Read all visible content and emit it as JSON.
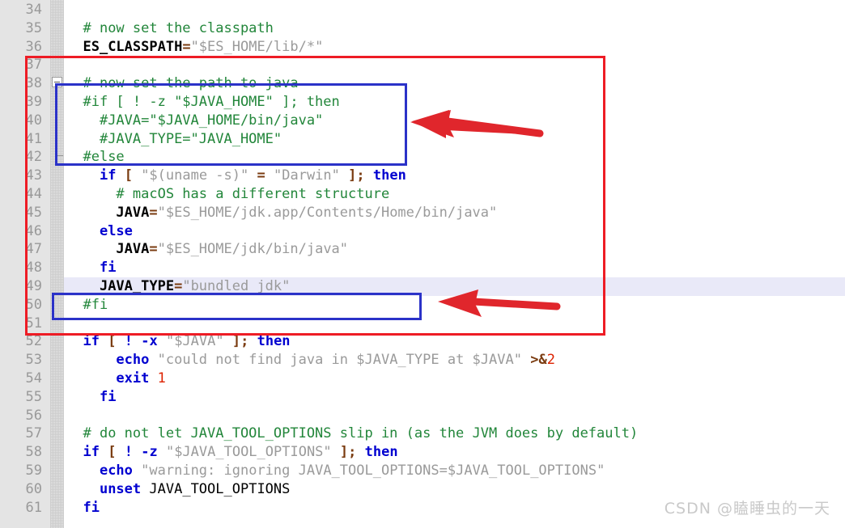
{
  "editor": {
    "first_line_number": 34,
    "highlighted_line": 49,
    "gutter_color": "#e4e4e4",
    "highlight_color": "#e9e9f8",
    "lines": [
      {
        "n": "34",
        "tokens": []
      },
      {
        "n": "35",
        "tokens": [
          {
            "t": "  ",
            "c": "pl"
          },
          {
            "t": "# now set the classpath",
            "c": "cm"
          }
        ]
      },
      {
        "n": "36",
        "tokens": [
          {
            "t": "  ",
            "c": "pl"
          },
          {
            "t": "ES_CLASSPATH",
            "c": "var"
          },
          {
            "t": "=",
            "c": "op"
          },
          {
            "t": "\"$ES_HOME/lib/*\"",
            "c": "st"
          }
        ]
      },
      {
        "n": "37",
        "tokens": []
      },
      {
        "n": "38",
        "tokens": [
          {
            "t": "  ",
            "c": "pl"
          },
          {
            "t": "# now set the path to java",
            "c": "cm"
          }
        ]
      },
      {
        "n": "39",
        "tokens": [
          {
            "t": "  ",
            "c": "pl"
          },
          {
            "t": "#if [ ! -z \"$JAVA_HOME\" ]; then",
            "c": "cm"
          }
        ]
      },
      {
        "n": "40",
        "tokens": [
          {
            "t": "    ",
            "c": "pl"
          },
          {
            "t": "#JAVA=\"$JAVA_HOME/bin/java\"",
            "c": "cm"
          }
        ]
      },
      {
        "n": "41",
        "tokens": [
          {
            "t": "    ",
            "c": "pl"
          },
          {
            "t": "#JAVA_TYPE=\"JAVA_HOME\"",
            "c": "cm"
          }
        ]
      },
      {
        "n": "42",
        "tokens": [
          {
            "t": "  ",
            "c": "pl"
          },
          {
            "t": "#else",
            "c": "cm"
          }
        ]
      },
      {
        "n": "43",
        "tokens": [
          {
            "t": "    ",
            "c": "pl"
          },
          {
            "t": "if",
            "c": "kw"
          },
          {
            "t": " ",
            "c": "pl"
          },
          {
            "t": "[",
            "c": "pn"
          },
          {
            "t": " ",
            "c": "pl"
          },
          {
            "t": "\"$(uname -s)\"",
            "c": "st"
          },
          {
            "t": " ",
            "c": "pl"
          },
          {
            "t": "=",
            "c": "op"
          },
          {
            "t": " ",
            "c": "pl"
          },
          {
            "t": "\"Darwin\"",
            "c": "st"
          },
          {
            "t": " ",
            "c": "pl"
          },
          {
            "t": "];",
            "c": "pn"
          },
          {
            "t": " ",
            "c": "pl"
          },
          {
            "t": "then",
            "c": "kw"
          }
        ]
      },
      {
        "n": "44",
        "tokens": [
          {
            "t": "      ",
            "c": "pl"
          },
          {
            "t": "# macOS has a different structure",
            "c": "cm"
          }
        ]
      },
      {
        "n": "45",
        "tokens": [
          {
            "t": "      ",
            "c": "pl"
          },
          {
            "t": "JAVA",
            "c": "var"
          },
          {
            "t": "=",
            "c": "op"
          },
          {
            "t": "\"$ES_HOME/jdk.app/Contents/Home/bin/java\"",
            "c": "st"
          }
        ]
      },
      {
        "n": "46",
        "tokens": [
          {
            "t": "    ",
            "c": "pl"
          },
          {
            "t": "else",
            "c": "kw"
          }
        ]
      },
      {
        "n": "47",
        "tokens": [
          {
            "t": "      ",
            "c": "pl"
          },
          {
            "t": "JAVA",
            "c": "var"
          },
          {
            "t": "=",
            "c": "op"
          },
          {
            "t": "\"$ES_HOME/jdk/bin/java\"",
            "c": "st"
          }
        ]
      },
      {
        "n": "48",
        "tokens": [
          {
            "t": "    ",
            "c": "pl"
          },
          {
            "t": "fi",
            "c": "kw"
          }
        ]
      },
      {
        "n": "49",
        "tokens": [
          {
            "t": "    ",
            "c": "pl"
          },
          {
            "t": "JAVA_TYPE",
            "c": "var"
          },
          {
            "t": "=",
            "c": "op"
          },
          {
            "t": "\"bundled_jdk\"",
            "c": "st"
          }
        ]
      },
      {
        "n": "50",
        "tokens": [
          {
            "t": "  ",
            "c": "pl"
          },
          {
            "t": "#fi",
            "c": "cm"
          }
        ]
      },
      {
        "n": "51",
        "tokens": []
      },
      {
        "n": "52",
        "tokens": [
          {
            "t": "  ",
            "c": "pl"
          },
          {
            "t": "if",
            "c": "kw"
          },
          {
            "t": " ",
            "c": "pl"
          },
          {
            "t": "[",
            "c": "pn"
          },
          {
            "t": " ",
            "c": "pl"
          },
          {
            "t": "!",
            "c": "kw"
          },
          {
            "t": " ",
            "c": "pl"
          },
          {
            "t": "-x",
            "c": "kw"
          },
          {
            "t": " ",
            "c": "pl"
          },
          {
            "t": "\"$JAVA\"",
            "c": "st"
          },
          {
            "t": " ",
            "c": "pl"
          },
          {
            "t": "];",
            "c": "pn"
          },
          {
            "t": " ",
            "c": "pl"
          },
          {
            "t": "then",
            "c": "kw"
          }
        ]
      },
      {
        "n": "53",
        "tokens": [
          {
            "t": "      ",
            "c": "pl"
          },
          {
            "t": "echo",
            "c": "kw"
          },
          {
            "t": " ",
            "c": "pl"
          },
          {
            "t": "\"could not find java in $JAVA_TYPE at $JAVA\"",
            "c": "st"
          },
          {
            "t": " ",
            "c": "pl"
          },
          {
            "t": ">&",
            "c": "op"
          },
          {
            "t": "2",
            "c": "nm"
          }
        ]
      },
      {
        "n": "54",
        "tokens": [
          {
            "t": "      ",
            "c": "pl"
          },
          {
            "t": "exit",
            "c": "kw"
          },
          {
            "t": " ",
            "c": "pl"
          },
          {
            "t": "1",
            "c": "nm"
          }
        ]
      },
      {
        "n": "55",
        "tokens": [
          {
            "t": "    ",
            "c": "pl"
          },
          {
            "t": "fi",
            "c": "kw"
          }
        ]
      },
      {
        "n": "56",
        "tokens": []
      },
      {
        "n": "57",
        "tokens": [
          {
            "t": "  ",
            "c": "pl"
          },
          {
            "t": "# do not let JAVA_TOOL_OPTIONS slip in (as the JVM does by default)",
            "c": "cm"
          }
        ]
      },
      {
        "n": "58",
        "tokens": [
          {
            "t": "  ",
            "c": "pl"
          },
          {
            "t": "if",
            "c": "kw"
          },
          {
            "t": " ",
            "c": "pl"
          },
          {
            "t": "[",
            "c": "pn"
          },
          {
            "t": " ",
            "c": "pl"
          },
          {
            "t": "!",
            "c": "kw"
          },
          {
            "t": " ",
            "c": "pl"
          },
          {
            "t": "-z",
            "c": "kw"
          },
          {
            "t": " ",
            "c": "pl"
          },
          {
            "t": "\"$JAVA_TOOL_OPTIONS\"",
            "c": "st"
          },
          {
            "t": " ",
            "c": "pl"
          },
          {
            "t": "];",
            "c": "pn"
          },
          {
            "t": " ",
            "c": "pl"
          },
          {
            "t": "then",
            "c": "kw"
          }
        ]
      },
      {
        "n": "59",
        "tokens": [
          {
            "t": "    ",
            "c": "pl"
          },
          {
            "t": "echo",
            "c": "kw"
          },
          {
            "t": " ",
            "c": "pl"
          },
          {
            "t": "\"warning: ignoring JAVA_TOOL_OPTIONS=$JAVA_TOOL_OPTIONS\"",
            "c": "st"
          }
        ]
      },
      {
        "n": "60",
        "tokens": [
          {
            "t": "    ",
            "c": "pl"
          },
          {
            "t": "unset",
            "c": "kw"
          },
          {
            "t": " ",
            "c": "pl"
          },
          {
            "t": "JAVA_TOOL_OPTIONS",
            "c": "pl"
          }
        ]
      },
      {
        "n": "61",
        "tokens": [
          {
            "t": "  ",
            "c": "pl"
          },
          {
            "t": "fi",
            "c": "kw"
          }
        ]
      }
    ]
  },
  "annotations": {
    "red_box": {
      "color": "#ee1c25",
      "covers_lines": "37-51"
    },
    "blue_box_top": {
      "color": "#2b32c8",
      "covers_lines": "38-42"
    },
    "blue_box_bottom": {
      "color": "#2b32c8",
      "covers_lines": "50"
    },
    "arrow_top": {
      "color": "#e0262c",
      "points_to": "blue-box-top"
    },
    "arrow_bottom": {
      "color": "#e0262c",
      "points_to": "blue-box-bottom"
    }
  },
  "watermark": {
    "text": "CSDN @瞌睡虫的一天"
  }
}
